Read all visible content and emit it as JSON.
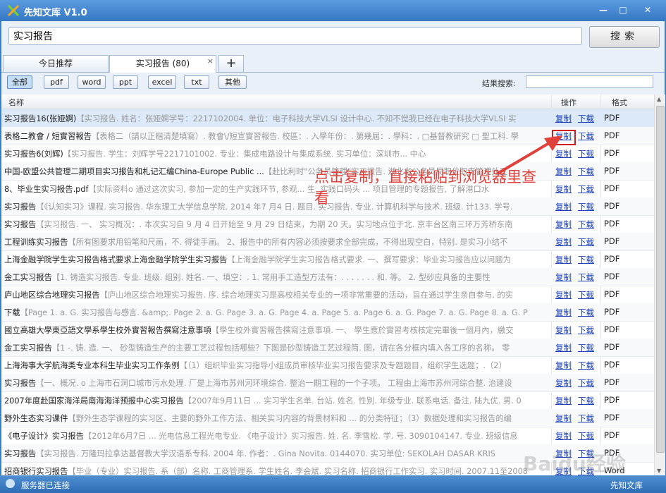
{
  "window": {
    "title": "先知文库 V1.0",
    "controls": [
      "—",
      "□",
      "✕"
    ]
  },
  "search": {
    "value": "实习报告",
    "button_label": "搜索"
  },
  "tabs": [
    {
      "label": "今日推荐"
    },
    {
      "label": "实习报告 (80)",
      "close": "×"
    },
    {
      "label": "+"
    }
  ],
  "filters": [
    "全部",
    "pdf",
    "word",
    "ppt",
    "excel",
    "txt",
    "其他"
  ],
  "result_search": {
    "label": "结果搜索:",
    "value": ""
  },
  "table": {
    "headers": {
      "name": "名称",
      "action": "操作",
      "format": "格式"
    },
    "copy_label": "复制",
    "download_label": "下载",
    "rows": [
      {
        "title": "实习报告16(张娅婀)",
        "snippet": "【实习报告. 姓名：张娅婀学号：2217102004. 单位：电子科技大学VLSI 设计中心. 不知不觉我已经在电子科技大学VLSI 实",
        "format": "PDF"
      },
      {
        "title": "表格二教會 / 短實習報告",
        "snippet": "【表格二（請以正楷清楚填寫）. 教會\\/短宣實習報告. 校區：. 入學年份：. 第幾屆：. 學科：. □基督教研究 □ 聖工科. 學",
        "format": "PDF"
      },
      {
        "title": "实习报告6(刘辉)",
        "snippet": "【实习报告. 学生：刘辉学号2217101002. 专业：集成电路设计与集成系统. 实习单位：深圳市... 中心",
        "format": "PDF"
      },
      {
        "title": "中国-欧盟公共管理二期项目实习报告和札记汇编China-Europe Public ...",
        "snippet": "【赴比利时\"公务员管理\"实习报告. 湖北省公务员局职位职责管理处王",
        "format": "PDF"
      },
      {
        "title": "8、毕业生实习报告.pdf",
        "snippet": "【实际资料o 通过这次实习, 参加一定的生产实践环节, 参观... 生, 实践口码头 ... 项目管理的专题报告, 了解港口水",
        "format": "PDF"
      },
      {
        "title": "实习报告",
        "snippet": "【《认知实习》课程. 实习报告. 华东理工大学信息学院. 2014 年7 月4 日. 题目. 实习报告. 专业. 计算机科学与技术. 班级. 计133. 学号.",
        "format": "PDF"
      },
      {
        "title": "实习报告",
        "snippet": "【实习报告. 一、 实习概况：. 本次实习自 9 月 4 日开始至 9 月 29 日结束，为期 20 天。实习地点位于北. 京丰台区南三环万芳桥东南",
        "format": "PDF"
      },
      {
        "title": "工程训练实习报告",
        "snippet": "【所有图要求用铅笔和尺画，不. 得徒手画。 2、报告中的所有内容必须按要求全部完成，不得出现空白，特别. 是实习小结不",
        "format": "PDF"
      },
      {
        "title": "上海金融学院学生实习报告格式要求上海金融学院学生实习报告",
        "snippet": "【上海金融学院学生实习报告格式要求. 一、撰写要求：毕业实习报告应以问题为",
        "format": "PDF"
      },
      {
        "title": "金工实习报告",
        "snippet": "【1. 铸造实习报告. 专业. 班级. 组别. 姓名. 一、填空：. 1. 常用手工造型方法有：. . . . . . . 和. 等。 2. 型砂应具备的主要性",
        "format": "PDF"
      },
      {
        "title": "庐山地区综合地理实习报告",
        "snippet": "【庐山地区综合地理实习报告. 序. 综合地理实习是高校相关专业的一项非常重要的活动，旨在通过学生亲自参与. 的实",
        "format": "PDF"
      },
      {
        "title": "下载",
        "snippet": "【Page 1. a. G. 实习报告与感言. &amp;. Page 2. a. G. Page 3. a. G. Page 4. a. Page 5. a. Page 6. a. G. Page 7. a. G. Page 8. a. G. P",
        "format": "PDF"
      },
      {
        "title": "國立高雄大學東亞語文學系學生校外實習報告撰寫注意事項",
        "snippet": "【學生校外實習報告撰寫注意事項. 一、 學生應於實習考核核定完畢後一個月內，繳交",
        "format": "PDF"
      },
      {
        "title": "金工实习报告",
        "snippet": "【1 -. 铸. 造. 一、 砂型铸造生产的主要工艺过程包括哪些？下图是砂型铸造工艺过程简. 图，请在各分框内填入各工序的名称。 零",
        "format": "PDF"
      },
      {
        "title": "上海海事大学航海类专业本科生毕业实习工作条例",
        "snippet": "【（1）组织毕业实习指导小组成员审核毕业实习报告要求及专题题目，组织学生选题；.（2）",
        "format": "PDF"
      },
      {
        "title": "实习报告",
        "snippet": "【一、概况. o 上海市石洞口城市污水处理. 厂是上海市苏州河环境综合. 整治一期工程的一个子项。 工程由上海市苏州河综合整. 治建设",
        "format": "PDF"
      },
      {
        "title": "2007年度赴国家海洋局南海海洋预报中心实习报告",
        "snippet": "【2007年9月11日 ... 实习学生名单. 台站. 姓名. 性别. 年级专业. 联系电话. 备注. 陆九优. 男. 0",
        "format": "PDF"
      },
      {
        "title": "野外生态实习课件",
        "snippet": "【野外生态学课程的实习区、主要的野外工作方法、相关实习内容的背景材料和 ... 的分类特征；（3）数据处理和实习报告的编",
        "format": "PDF"
      },
      {
        "title": "《电子设计》实习报告",
        "snippet": "【2012年6月7日 ... 光电信息工程光电专业. 《电子设计》实习报告. 姓. 名. 李雪松. 学. 号. 3090104147. 专业. 班级信息",
        "format": "PDF"
      },
      {
        "title": "实习报告",
        "snippet": "【实习报告. 万隆玛拉拿达基督教大学汉语系专科. 2004 年. 作者：. Gina Novita. 0144070. 实习单位: SEKOLAH DASAR KRIS",
        "format": "PDF"
      },
      {
        "title": "招商银行实习报告",
        "snippet": "【毕业（专业）实习报告. 系（部）名称. 工商管理系. 学生姓名. 李会斌. 实习名称. 招商银行工作实习. 实习时间. 2007.11至2008",
        "format": "Word"
      }
    ]
  },
  "annotation": "点击复制，直接粘贴到浏览器里查看",
  "watermark": "Baidu经验",
  "statusbar": {
    "status": "服务器已连接",
    "app_name": "先知文库"
  }
}
